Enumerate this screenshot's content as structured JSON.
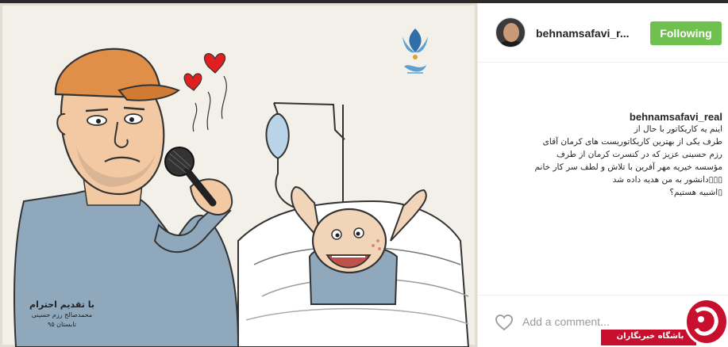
{
  "post": {
    "image": {
      "caption_title": "با تقدیم احترام",
      "caption_lines": [
        "محمدصالح رزم حسینی",
        "تابستان ۹۵"
      ]
    }
  },
  "header": {
    "username": "behnamsafavi_r...",
    "follow_label": "Following"
  },
  "comment": {
    "username": "behnamsafavi_real",
    "text": "اینم یه کاریکاتور با حال از\nطرف یکی از بهترین کاریکاتوریست های کرمان آقای\nرزم حسینی عزیز که در کنسرت کرمان از طرف\nمؤسسه خیریه مهر آفرین با تلاش و لطف سر کار خانم\n▯▯▯دانشور به من هدیه داده شد\n▯اشبیه هستیم؟"
  },
  "footer": {
    "comment_placeholder": "Add a comment..."
  },
  "watermark": {
    "text": "باشگاه خبرنگاران"
  },
  "colors": {
    "follow_button": "#70c050",
    "watermark_red": "#c8102e"
  }
}
